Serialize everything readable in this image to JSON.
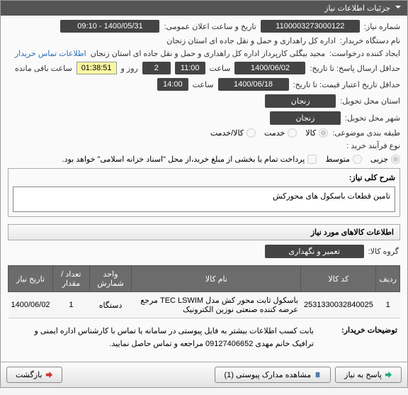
{
  "panel_title": "جزئیات اطلاعات نیاز",
  "labels": {
    "need_no": "شماره نیاز:",
    "announce_dt": "تاریخ و ساعت اعلان عمومی:",
    "buyer_org": "نام دستگاه خریدار:",
    "creator": "ایجاد کننده درخواست:",
    "contact_link": "اطلاعات تماس خریدار",
    "deadline": "حداقل ارسال پاسخ: تا تاریخ:",
    "hour_lbl": "ساعت",
    "deadline_days": "روز و",
    "remaining": "ساعت باقی مانده",
    "credit_deadline": "حداقل تاریخ اعتبار قیمت: تا تاریخ:",
    "state": "استان محل تحویل:",
    "city": "شهر محل تحویل:",
    "category": "طبقه بندی موضوعی:",
    "option_goods": "کالا",
    "option_service": "خدمت",
    "option_both": "کالا/خدمت",
    "buy_process": "نوع فرآیند خرید :",
    "proc_part": "جزیی",
    "proc_mid": "متوسط",
    "proc_note": "پرداخت تمام یا بخشی از مبلغ خرید،از محل \"اسناد خزانه اسلامی\" خواهد بود.",
    "general_desc_lbl": "شرح کلی نیاز:",
    "items_header": "اطلاعات کالاهای مورد نیاز",
    "item_group_lbl": "گروه کالا:",
    "buyer_note_lbl": "توضیحات خریدار:"
  },
  "values": {
    "need_no": "1100003273000122",
    "announce_dt": "1400/05/31 - 09:10",
    "buyer_org": "اداره کل راهداری و حمل و نقل جاده ای استان زنجان",
    "creator": "مجید بیگلی کارپرداز اداره کل راهداری و حمل و نقل جاده ای استان زنجان",
    "deadline_date": "1400/06/02",
    "deadline_time": "11:00",
    "deadline_days": "2",
    "countdown": "01:38:51",
    "credit_date": "1400/06/18",
    "credit_time": "14:00",
    "state": "زنجان",
    "city": "زنجان",
    "category_selected": "goods",
    "proc_selected": "part",
    "proc_checkbox": false,
    "general_desc": "تامین قطعات باسکول های محورکش",
    "item_group": "تعمیر و نگهداری",
    "buyer_note": "بابت کسب اطلاعات بیشتر به فایل پیوستی در سامانه یا تماس با کارشناس اداره ایمنی و ترافیک خانم مهدی 09127406652 مراجعه و تماس حاصل نمایید."
  },
  "table": {
    "headers": {
      "row": "ردیف",
      "code": "کد کالا",
      "name": "نام کالا",
      "unit": "واحد شمارش",
      "qty": "تعداد / مقدار",
      "date": "تاریخ نیاز"
    },
    "rows": [
      {
        "row": "1",
        "code": "2531330032840025",
        "name": "باسکول ثابت محور کش مدل TEC LSWIM مرجع عرضه کننده صنعتی نوزین الکترونیک",
        "unit": "دستگاه",
        "qty": "1",
        "date": "1400/06/02"
      }
    ]
  },
  "footer": {
    "reply": "پاسخ به نیاز",
    "attachments": "مشاهده مدارک پیوستی (1)",
    "back": "بازگشت"
  }
}
